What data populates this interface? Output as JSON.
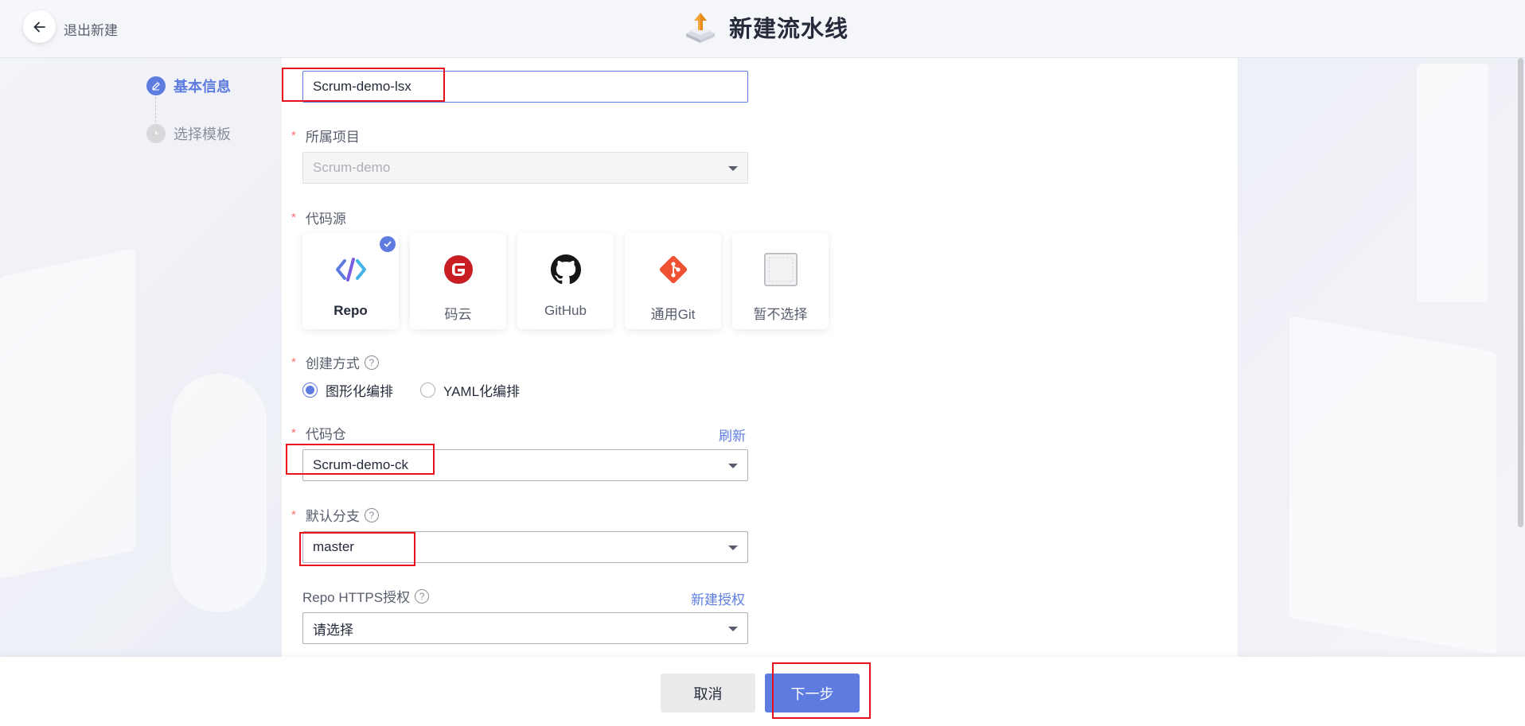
{
  "header": {
    "back_label": "退出新建",
    "title": "新建流水线"
  },
  "steps": [
    {
      "label": "基本信息",
      "state": "active"
    },
    {
      "label": "选择模板",
      "state": "pending"
    }
  ],
  "form": {
    "name": {
      "value": "Scrum-demo-lsx"
    },
    "project": {
      "label": "所属项目",
      "value": "Scrum-demo"
    },
    "source": {
      "label": "代码源",
      "options": [
        {
          "name": "Repo",
          "icon": "repo-icon",
          "selected": true
        },
        {
          "name": "码云",
          "icon": "gitee-icon",
          "selected": false
        },
        {
          "name": "GitHub",
          "icon": "github-icon",
          "selected": false
        },
        {
          "name": "通用Git",
          "icon": "git-icon",
          "selected": false
        },
        {
          "name": "暂不选择",
          "icon": "none-icon",
          "selected": false
        }
      ]
    },
    "create_mode": {
      "label": "创建方式",
      "options": [
        {
          "label": "图形化编排",
          "checked": true
        },
        {
          "label": "YAML化编排",
          "checked": false
        }
      ]
    },
    "repo": {
      "label": "代码仓",
      "value": "Scrum-demo-ck",
      "action": "刷新"
    },
    "branch": {
      "label": "默认分支",
      "value": "master"
    },
    "https_auth": {
      "label": "Repo HTTPS授权",
      "placeholder": "请选择",
      "action": "新建授权"
    }
  },
  "footer": {
    "cancel_label": "取消",
    "next_label": "下一步"
  },
  "colors": {
    "accent": "#5e7ce0",
    "required": "#f66f6a",
    "highlight_box": "#e8101a"
  }
}
